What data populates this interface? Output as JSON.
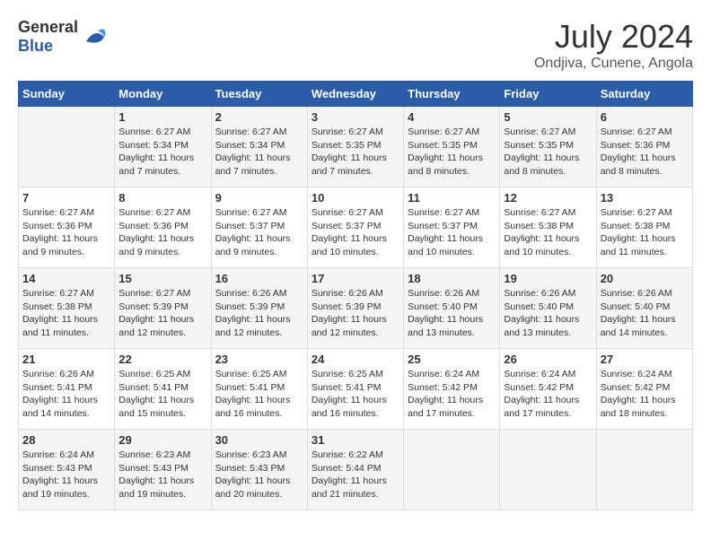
{
  "header": {
    "logo_general": "General",
    "logo_blue": "Blue",
    "month": "July 2024",
    "location": "Ondjiva, Cunene, Angola"
  },
  "columns": [
    "Sunday",
    "Monday",
    "Tuesday",
    "Wednesday",
    "Thursday",
    "Friday",
    "Saturday"
  ],
  "weeks": [
    [
      {
        "day": "",
        "sunrise": "",
        "sunset": "",
        "daylight": ""
      },
      {
        "day": "1",
        "sunrise": "Sunrise: 6:27 AM",
        "sunset": "Sunset: 5:34 PM",
        "daylight": "Daylight: 11 hours and 7 minutes."
      },
      {
        "day": "2",
        "sunrise": "Sunrise: 6:27 AM",
        "sunset": "Sunset: 5:34 PM",
        "daylight": "Daylight: 11 hours and 7 minutes."
      },
      {
        "day": "3",
        "sunrise": "Sunrise: 6:27 AM",
        "sunset": "Sunset: 5:35 PM",
        "daylight": "Daylight: 11 hours and 7 minutes."
      },
      {
        "day": "4",
        "sunrise": "Sunrise: 6:27 AM",
        "sunset": "Sunset: 5:35 PM",
        "daylight": "Daylight: 11 hours and 8 minutes."
      },
      {
        "day": "5",
        "sunrise": "Sunrise: 6:27 AM",
        "sunset": "Sunset: 5:35 PM",
        "daylight": "Daylight: 11 hours and 8 minutes."
      },
      {
        "day": "6",
        "sunrise": "Sunrise: 6:27 AM",
        "sunset": "Sunset: 5:36 PM",
        "daylight": "Daylight: 11 hours and 8 minutes."
      }
    ],
    [
      {
        "day": "7",
        "sunrise": "Sunrise: 6:27 AM",
        "sunset": "Sunset: 5:36 PM",
        "daylight": "Daylight: 11 hours and 9 minutes."
      },
      {
        "day": "8",
        "sunrise": "Sunrise: 6:27 AM",
        "sunset": "Sunset: 5:36 PM",
        "daylight": "Daylight: 11 hours and 9 minutes."
      },
      {
        "day": "9",
        "sunrise": "Sunrise: 6:27 AM",
        "sunset": "Sunset: 5:37 PM",
        "daylight": "Daylight: 11 hours and 9 minutes."
      },
      {
        "day": "10",
        "sunrise": "Sunrise: 6:27 AM",
        "sunset": "Sunset: 5:37 PM",
        "daylight": "Daylight: 11 hours and 10 minutes."
      },
      {
        "day": "11",
        "sunrise": "Sunrise: 6:27 AM",
        "sunset": "Sunset: 5:37 PM",
        "daylight": "Daylight: 11 hours and 10 minutes."
      },
      {
        "day": "12",
        "sunrise": "Sunrise: 6:27 AM",
        "sunset": "Sunset: 5:38 PM",
        "daylight": "Daylight: 11 hours and 10 minutes."
      },
      {
        "day": "13",
        "sunrise": "Sunrise: 6:27 AM",
        "sunset": "Sunset: 5:38 PM",
        "daylight": "Daylight: 11 hours and 11 minutes."
      }
    ],
    [
      {
        "day": "14",
        "sunrise": "Sunrise: 6:27 AM",
        "sunset": "Sunset: 5:38 PM",
        "daylight": "Daylight: 11 hours and 11 minutes."
      },
      {
        "day": "15",
        "sunrise": "Sunrise: 6:27 AM",
        "sunset": "Sunset: 5:39 PM",
        "daylight": "Daylight: 11 hours and 12 minutes."
      },
      {
        "day": "16",
        "sunrise": "Sunrise: 6:26 AM",
        "sunset": "Sunset: 5:39 PM",
        "daylight": "Daylight: 11 hours and 12 minutes."
      },
      {
        "day": "17",
        "sunrise": "Sunrise: 6:26 AM",
        "sunset": "Sunset: 5:39 PM",
        "daylight": "Daylight: 11 hours and 12 minutes."
      },
      {
        "day": "18",
        "sunrise": "Sunrise: 6:26 AM",
        "sunset": "Sunset: 5:40 PM",
        "daylight": "Daylight: 11 hours and 13 minutes."
      },
      {
        "day": "19",
        "sunrise": "Sunrise: 6:26 AM",
        "sunset": "Sunset: 5:40 PM",
        "daylight": "Daylight: 11 hours and 13 minutes."
      },
      {
        "day": "20",
        "sunrise": "Sunrise: 6:26 AM",
        "sunset": "Sunset: 5:40 PM",
        "daylight": "Daylight: 11 hours and 14 minutes."
      }
    ],
    [
      {
        "day": "21",
        "sunrise": "Sunrise: 6:26 AM",
        "sunset": "Sunset: 5:41 PM",
        "daylight": "Daylight: 11 hours and 14 minutes."
      },
      {
        "day": "22",
        "sunrise": "Sunrise: 6:25 AM",
        "sunset": "Sunset: 5:41 PM",
        "daylight": "Daylight: 11 hours and 15 minutes."
      },
      {
        "day": "23",
        "sunrise": "Sunrise: 6:25 AM",
        "sunset": "Sunset: 5:41 PM",
        "daylight": "Daylight: 11 hours and 16 minutes."
      },
      {
        "day": "24",
        "sunrise": "Sunrise: 6:25 AM",
        "sunset": "Sunset: 5:41 PM",
        "daylight": "Daylight: 11 hours and 16 minutes."
      },
      {
        "day": "25",
        "sunrise": "Sunrise: 6:24 AM",
        "sunset": "Sunset: 5:42 PM",
        "daylight": "Daylight: 11 hours and 17 minutes."
      },
      {
        "day": "26",
        "sunrise": "Sunrise: 6:24 AM",
        "sunset": "Sunset: 5:42 PM",
        "daylight": "Daylight: 11 hours and 17 minutes."
      },
      {
        "day": "27",
        "sunrise": "Sunrise: 6:24 AM",
        "sunset": "Sunset: 5:42 PM",
        "daylight": "Daylight: 11 hours and 18 minutes."
      }
    ],
    [
      {
        "day": "28",
        "sunrise": "Sunrise: 6:24 AM",
        "sunset": "Sunset: 5:43 PM",
        "daylight": "Daylight: 11 hours and 19 minutes."
      },
      {
        "day": "29",
        "sunrise": "Sunrise: 6:23 AM",
        "sunset": "Sunset: 5:43 PM",
        "daylight": "Daylight: 11 hours and 19 minutes."
      },
      {
        "day": "30",
        "sunrise": "Sunrise: 6:23 AM",
        "sunset": "Sunset: 5:43 PM",
        "daylight": "Daylight: 11 hours and 20 minutes."
      },
      {
        "day": "31",
        "sunrise": "Sunrise: 6:22 AM",
        "sunset": "Sunset: 5:44 PM",
        "daylight": "Daylight: 11 hours and 21 minutes."
      },
      {
        "day": "",
        "sunrise": "",
        "sunset": "",
        "daylight": ""
      },
      {
        "day": "",
        "sunrise": "",
        "sunset": "",
        "daylight": ""
      },
      {
        "day": "",
        "sunrise": "",
        "sunset": "",
        "daylight": ""
      }
    ]
  ]
}
